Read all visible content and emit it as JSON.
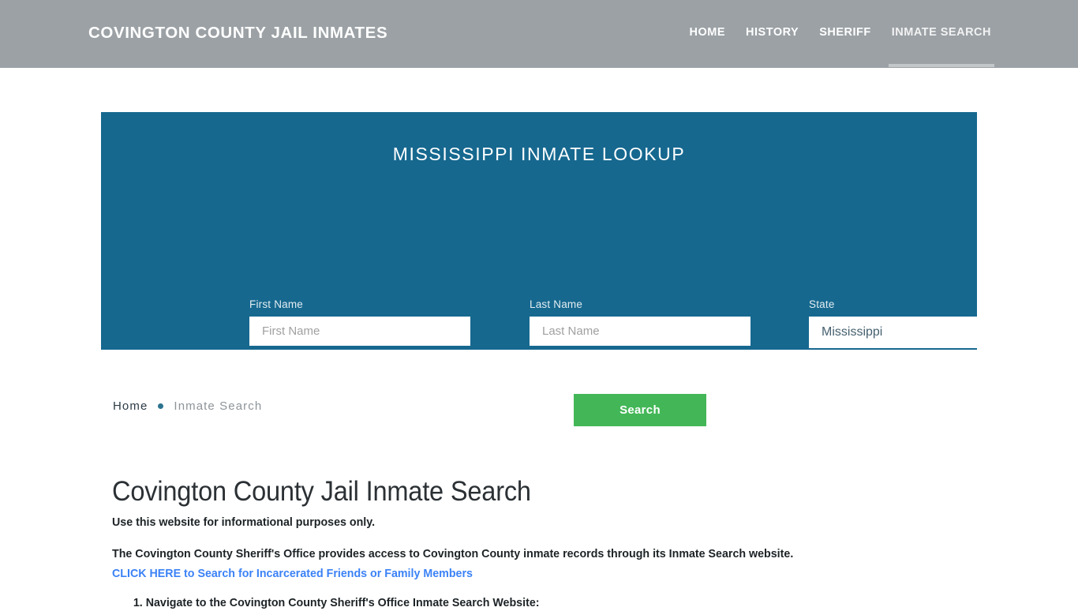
{
  "header": {
    "site_title": "COVINGTON COUNTY JAIL INMATES",
    "background_color": "#9ba1a5",
    "nav": [
      {
        "label": "HOME",
        "active": false
      },
      {
        "label": "HISTORY",
        "active": false
      },
      {
        "label": "SHERIFF",
        "active": false
      },
      {
        "label": "INMATE SEARCH",
        "active": true
      }
    ]
  },
  "search_panel": {
    "heading": "MISSISSIPPI INMATE LOOKUP",
    "background_color": "#16688f",
    "fields": {
      "first_name": {
        "label": "First Name",
        "placeholder": "First Name",
        "value": ""
      },
      "last_name": {
        "label": "Last Name",
        "placeholder": "Last Name",
        "value": ""
      },
      "state": {
        "label": "State",
        "placeholder": "State",
        "value": "Mississippi"
      }
    },
    "search_button": {
      "label": "Search",
      "color": "#43b757"
    }
  },
  "breadcrumb": {
    "home": "Home",
    "separator": "bullet-icon",
    "current": "Inmate Search"
  },
  "main": {
    "page_title": "Covington County Jail Inmate Search",
    "paragraph_1": "Use this website for informational purposes only.",
    "paragraph_2": "The Covington County Sheriff's Office provides access to Covington County inmate records through its Inmate Search website.",
    "link_text": "CLICK HERE to Search for Incarcerated Friends or Family Members",
    "link_color": "#3b82f6",
    "steps": [
      "Navigate to the Covington County Sheriff's Office Inmate Search Website:"
    ]
  }
}
